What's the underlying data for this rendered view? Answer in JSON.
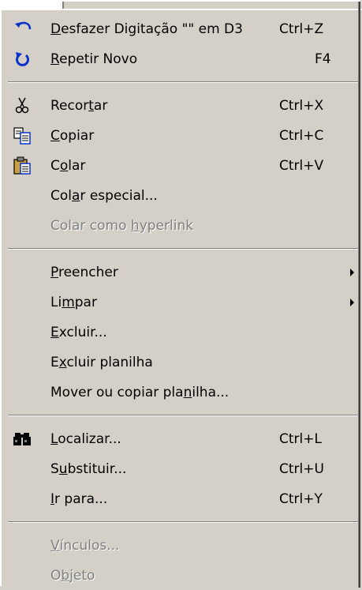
{
  "menu": {
    "undo": {
      "pre": "",
      "ul": "D",
      "post": "esfazer Digitação \"\" em D3",
      "shortcut": "Ctrl+Z",
      "icon": "undo-icon"
    },
    "redo": {
      "pre": "",
      "ul": "R",
      "post": "epetir Novo",
      "shortcut": "F4",
      "icon": "redo-icon"
    },
    "cut": {
      "pre": "Recor",
      "ul": "t",
      "post": "ar",
      "shortcut": "Ctrl+X",
      "icon": "scissors-icon"
    },
    "copy": {
      "pre": "",
      "ul": "C",
      "post": "opiar",
      "shortcut": "Ctrl+C",
      "icon": "copy-icon"
    },
    "paste": {
      "pre": "C",
      "ul": "o",
      "post": "lar",
      "shortcut": "Ctrl+V",
      "icon": "paste-icon"
    },
    "paste_special": {
      "pre": "Col",
      "ul": "a",
      "post": "r especial...",
      "shortcut": ""
    },
    "paste_hyperlink": {
      "pre": "Colar como ",
      "ul": "h",
      "post": "yperlink",
      "shortcut": "",
      "disabled": true
    },
    "fill": {
      "pre": "",
      "ul": "P",
      "post": "reencher",
      "shortcut": "",
      "submenu": true
    },
    "clear": {
      "pre": "Li",
      "ul": "m",
      "post": "par",
      "shortcut": "",
      "submenu": true
    },
    "delete": {
      "pre": "",
      "ul": "E",
      "post": "xcluir...",
      "shortcut": ""
    },
    "delete_sheet": {
      "pre": "E",
      "ul": "x",
      "post": "cluir planilha",
      "shortcut": ""
    },
    "move_copy_sheet": {
      "pre": "Mover ou copiar pla",
      "ul": "n",
      "post": "ilha...",
      "shortcut": ""
    },
    "find": {
      "pre": "",
      "ul": "L",
      "post": "ocalizar...",
      "shortcut": "Ctrl+L",
      "icon": "binoculars-icon"
    },
    "replace": {
      "pre": "S",
      "ul": "u",
      "post": "bstituir...",
      "shortcut": "Ctrl+U"
    },
    "goto": {
      "pre": "",
      "ul": "I",
      "post": "r para...",
      "shortcut": "Ctrl+Y"
    },
    "links": {
      "pre": "",
      "ul": "V",
      "post": "ínculos...",
      "shortcut": "",
      "disabled": true
    },
    "object": {
      "pre": "O",
      "ul": "b",
      "post": "jeto",
      "shortcut": "",
      "disabled": true
    }
  },
  "colors": {
    "menu_bg": "#d4d0c8",
    "disabled_text": "#808080",
    "icon_blue": "#0a32c8"
  }
}
